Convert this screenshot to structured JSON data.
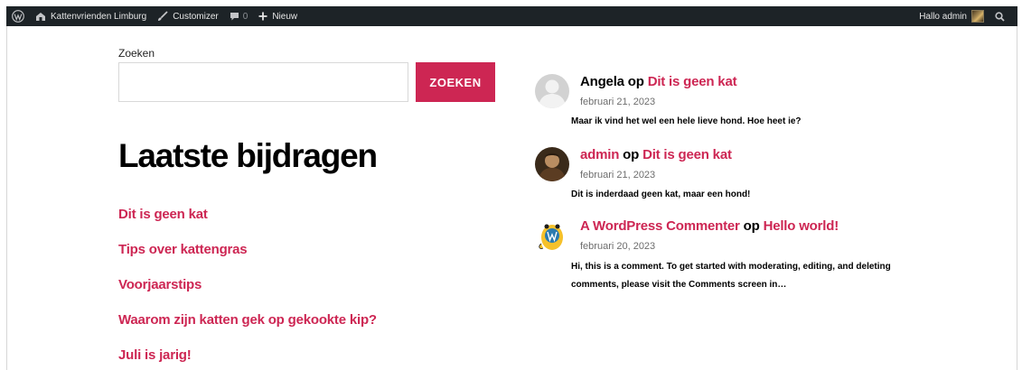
{
  "admin_bar": {
    "site_name": "Kattenvrienden Limburg",
    "customizer": "Customizer",
    "comments_count": "0",
    "new_label": "Nieuw",
    "greeting": "Hallo admin"
  },
  "search": {
    "label": "Zoeken",
    "value": "",
    "placeholder": "",
    "button": "ZOEKEN"
  },
  "recent_posts": {
    "title": "Laatste bijdragen",
    "items": [
      "Dit is geen kat",
      "Tips over kattengras",
      "Voorjaarstips",
      "Waarom zijn katten gek op gekookte kip?",
      "Juli is jarig!"
    ]
  },
  "recent_comments": [
    {
      "author": "Angela",
      "connector": "op",
      "post": "Dit is geen kat",
      "date": "februari 21, 2023",
      "excerpt": "Maar ik vind het wel een hele lieve hond. Hoe heet ie?",
      "avatar": "default-avatar-icon"
    },
    {
      "author": "admin",
      "connector": "op",
      "post": "Dit is geen kat",
      "date": "februari 21, 2023",
      "excerpt": "Dit is inderdaad geen kat, maar een hond!",
      "avatar": "admin-photo"
    },
    {
      "author": "A WordPress Commenter",
      "connector": "op",
      "post": "Hello world!",
      "date": "februari 20, 2023",
      "excerpt": "Hi, this is a comment. To get started with moderating, editing, and deleting comments, please visit the Comments screen in…",
      "avatar": "wapuu-icon"
    }
  ],
  "colors": {
    "accent": "#cd2653",
    "admin_bar": "#1d2327"
  }
}
